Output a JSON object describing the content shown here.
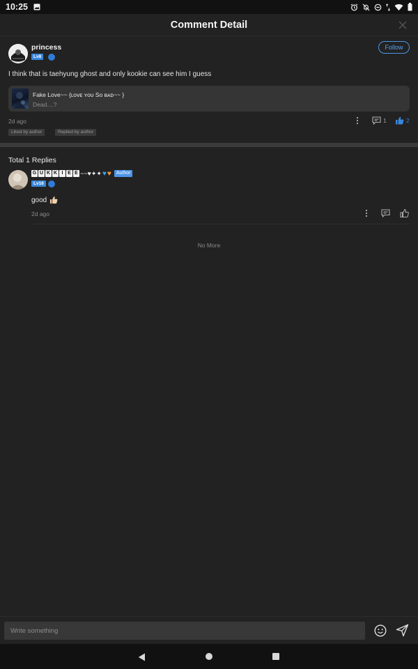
{
  "status_bar": {
    "time": "10:25"
  },
  "header": {
    "title": "Comment Detail"
  },
  "comment": {
    "username": "princess",
    "level": "Lv8",
    "follow_label": "Follow",
    "text": "I think that is taehyung ghost and only kookie can see him I guess",
    "post": {
      "title": "Fake Love~~ {ʟᴏᴠᴇ ʏᴏᴜ Sᴏ ʙᴀᴅ~~ }",
      "subtitle": "Dead....?"
    },
    "time": "2d ago",
    "reply_count": "1",
    "like_count": "2",
    "tags": [
      "Liked by author",
      "Replied by author"
    ]
  },
  "replies": {
    "total_label": "Total 1 Replies",
    "items": [
      {
        "name_letters": [
          "G",
          "U",
          "K",
          "K",
          "I",
          "E",
          "E"
        ],
        "name_suffix": "~~♥✦✦",
        "author_label": "Author",
        "level": "Lv16",
        "text": "good",
        "time": "2d ago"
      }
    ]
  },
  "no_more": "No More",
  "input": {
    "placeholder": "Write something"
  },
  "colors": {
    "accent": "#4b96e6",
    "like_active": "#3a86d9",
    "background": "#222222"
  }
}
